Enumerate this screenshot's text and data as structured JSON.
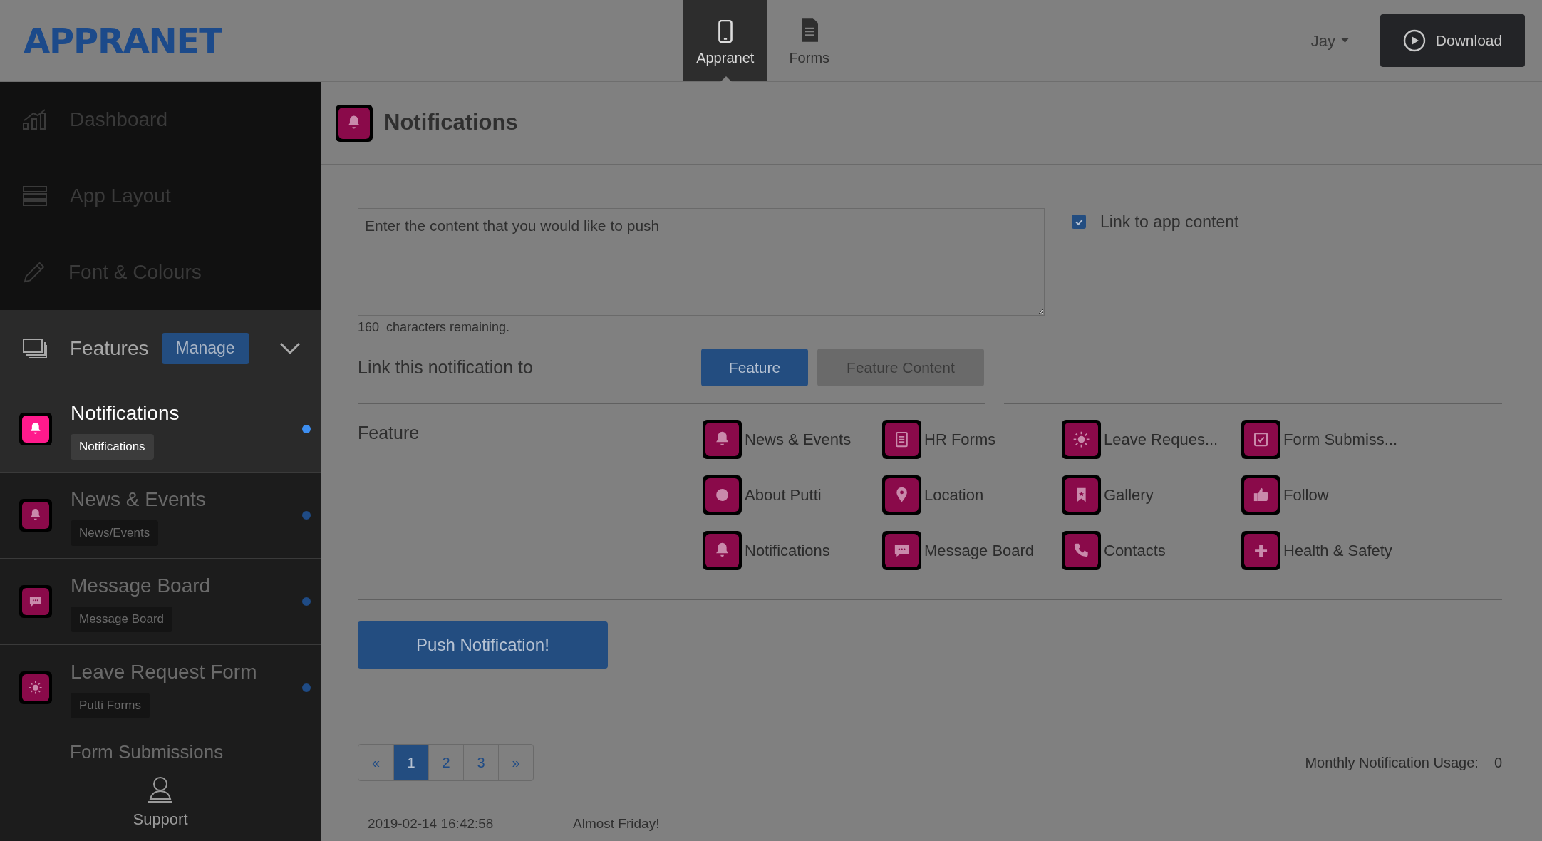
{
  "header": {
    "logo": "APPRANET",
    "nav_tabs": [
      {
        "label": "Appranet",
        "selected": true
      },
      {
        "label": "Forms",
        "selected": false
      }
    ],
    "user": "Jay",
    "download": "Download"
  },
  "sidebar": {
    "items": [
      "Dashboard",
      "App Layout",
      "Font & Colours"
    ],
    "features": {
      "label": "Features",
      "manage": "Manage"
    },
    "feature_items": [
      {
        "title": "Notifications",
        "tag": "Notifications",
        "selected": true
      },
      {
        "title": "News & Events",
        "tag": "News/Events",
        "selected": false
      },
      {
        "title": "Message Board",
        "tag": "Message Board",
        "selected": false
      },
      {
        "title": "Leave Request Form",
        "tag": "Putti Forms",
        "selected": false
      }
    ],
    "partial_item": "Form Submissions",
    "support": "Support"
  },
  "page": {
    "title": "Notifications",
    "message": {
      "placeholder": "Enter the content that you would like to push"
    },
    "chars_remaining": "160  characters remaining.",
    "link_to_app_content": {
      "label": "Link to app content",
      "checked": true
    },
    "link_row": {
      "label": "Link this notification to",
      "options": [
        {
          "label": "Feature",
          "selected": true
        },
        {
          "label": "Feature Content",
          "selected": false
        }
      ]
    },
    "feature_section": {
      "label": "Feature",
      "items": [
        "News & Events",
        "HR Forms",
        "Leave Reques...",
        "Form Submiss...",
        "About Putti",
        "Location",
        "Gallery",
        "Follow",
        "Notifications",
        "Message Board",
        "Contacts",
        "Health & Safety"
      ]
    },
    "push_button": "Push Notification!",
    "pagination": [
      {
        "label": "«",
        "selected": false
      },
      {
        "label": "1",
        "selected": true
      },
      {
        "label": "2",
        "selected": false
      },
      {
        "label": "3",
        "selected": false
      },
      {
        "label": "»",
        "selected": false
      }
    ],
    "usage": {
      "label": "Monthly Notification Usage:",
      "value": "0"
    },
    "history": [
      {
        "date": "2019-02-14 16:42:58",
        "message": "Almost Friday!"
      }
    ]
  }
}
